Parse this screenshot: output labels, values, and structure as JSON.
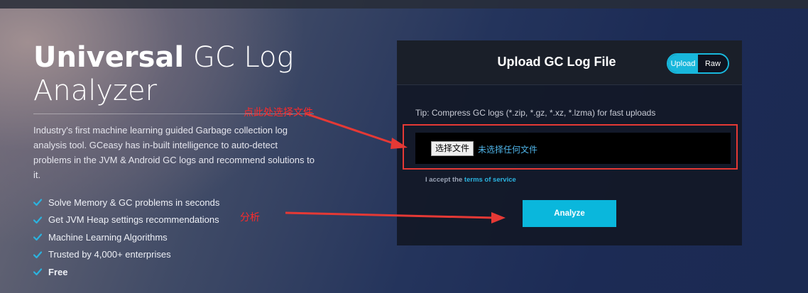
{
  "hero": {
    "title_bold": "Universal",
    "title_rest": " GC Log",
    "title_line2": "Analyzer",
    "description": "Industry's first machine learning guided Garbage collection log analysis tool. GCeasy has in-built intelligence to auto-detect problems in the JVM & Android GC logs and recommend solutions to it.",
    "features": [
      "Solve Memory & GC problems in seconds",
      "Get JVM Heap settings recommendations",
      "Machine Learning Algorithms",
      "Trusted by 4,000+ enterprises",
      "Free"
    ]
  },
  "panel": {
    "title": "Upload GC Log File",
    "toggle": {
      "upload": "Upload",
      "raw": "Raw",
      "active": "Upload"
    },
    "tip": "Tip: Compress GC logs (*.zip, *.gz, *.xz, *.lzma) for fast uploads",
    "file_button": "选择文件",
    "file_status": "未选择任何文件",
    "terms_prefix": "I accept the ",
    "terms_link": "terms of service",
    "analyze": "Analyze"
  },
  "annotations": {
    "choose_file": "点此处选择文件",
    "analyze": "分析",
    "color": "#ff2a2a"
  },
  "colors": {
    "accent": "#0ab7dc",
    "check": "#2bb3df",
    "highlight_box": "#e53935"
  },
  "icons": {
    "feature_bullet": "check-icon"
  }
}
